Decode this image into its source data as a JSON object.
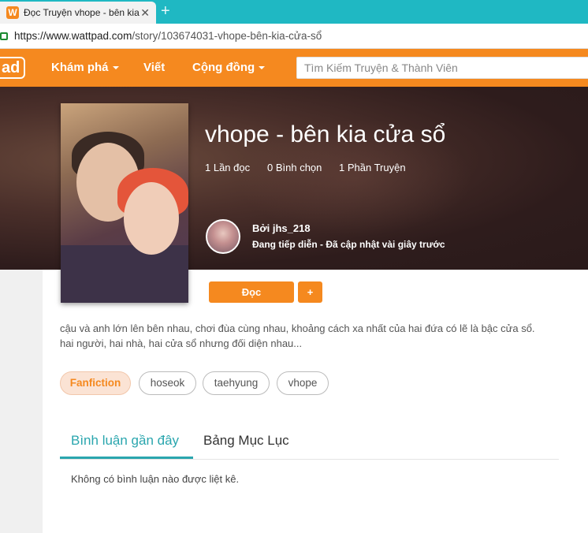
{
  "browser": {
    "tab_title": "Đọc Truyện vhope - bên kia",
    "tab_close": "✕",
    "new_tab": "+",
    "favicon_letter": "W",
    "url_host": "https://www.wattpad.com",
    "url_path": "/story/103674031-vhope-bên-kia-cửa-sổ"
  },
  "header": {
    "logo_text": "ad",
    "nav": [
      {
        "label": "Khám phá",
        "has_caret": true
      },
      {
        "label": "Viết",
        "has_caret": false
      },
      {
        "label": "Cộng đồng",
        "has_caret": true
      }
    ],
    "search_placeholder": "Tìm Kiếm Truyện & Thành Viên"
  },
  "story": {
    "title": "vhope - bên kia cửa sổ",
    "stats": [
      "1 Lần đọc",
      "0 Bình chọn",
      "1 Phần Truyện"
    ],
    "author": "Bởi jhs_218",
    "status": "Đang tiếp diễn - Đã cập nhật vài giây trước",
    "read_button": "Đọc",
    "add_button": "+",
    "description_line1": "cậu và anh lớn lên bên nhau, chơi đùa cùng nhau, khoảng cách xa nhất của hai đứa có lẽ là bậc cửa sổ.",
    "description_line2": "hai người, hai nhà, hai cửa sổ nhưng đối diện nhau...",
    "tags": [
      "Fanfiction",
      "hoseok",
      "taehyung",
      "vhope"
    ]
  },
  "tabs": {
    "active": "Bình luận gần đây",
    "inactive": "Bảng Mục Lục"
  },
  "comments": {
    "empty_text": "Không có bình luận nào được liệt kê."
  },
  "colors": {
    "accent": "#f5891f",
    "teal": "#2aa6ae",
    "browser": "#1fb8c3"
  }
}
